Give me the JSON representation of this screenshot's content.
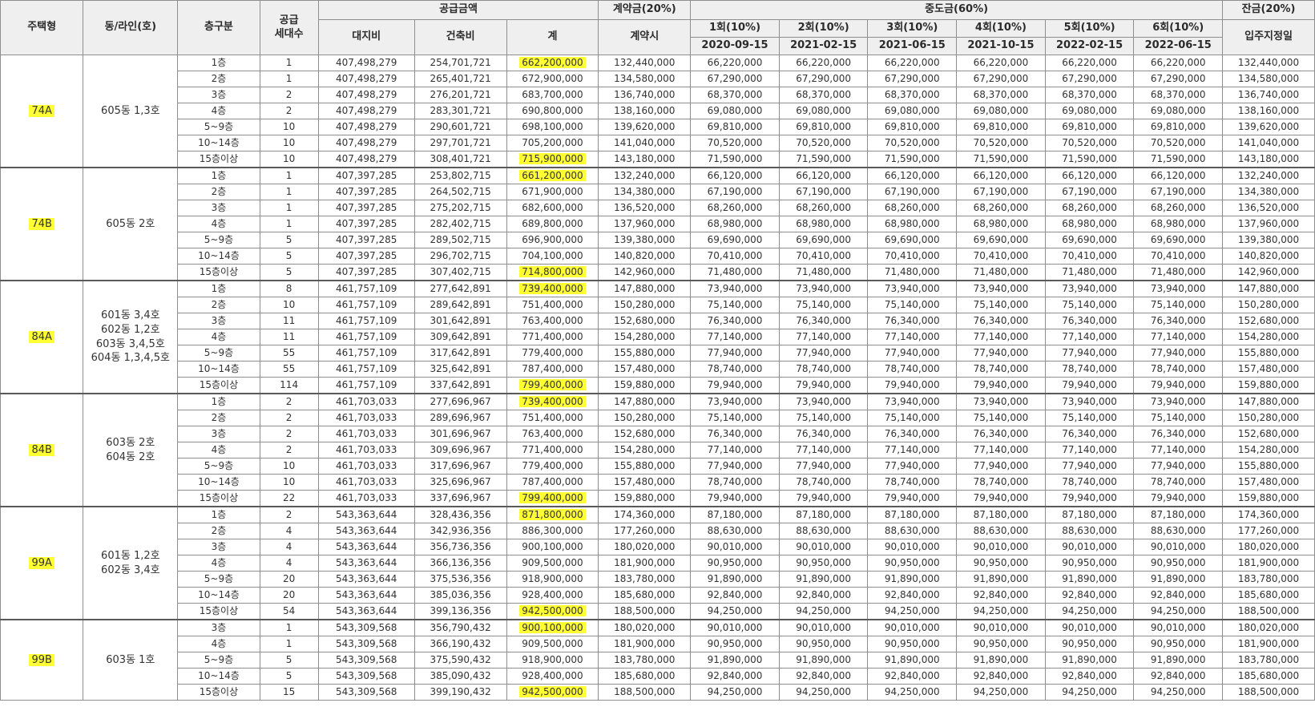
{
  "colors": {
    "highlight": "#ffff33",
    "header_bg": "#efefef",
    "border": "#8e8e8e"
  },
  "header": {
    "type": "주택형",
    "dong": "동/라인(호)",
    "floor": "층구분",
    "units": "공급\n세대수",
    "supply": "공급금액",
    "land": "대지비",
    "build": "건축비",
    "total": "계",
    "deposit": "계약금(20%)",
    "deposit_when": "계약시",
    "mid": "중도금(60%)",
    "mid_rounds": [
      "1회(10%)",
      "2회(10%)",
      "3회(10%)",
      "4회(10%)",
      "5회(10%)",
      "6회(10%)"
    ],
    "mid_dates": [
      "2020-09-15",
      "2021-02-15",
      "2021-06-15",
      "2021-10-15",
      "2022-02-15",
      "2022-06-15"
    ],
    "balance": "잔금(20%)",
    "balance_when": "입주지정일"
  },
  "groups": [
    {
      "type": "74A",
      "dong": "605동 1,3호",
      "rows": [
        {
          "floor": "1층",
          "units": "1",
          "land": "407,498,279",
          "build": "254,701,721",
          "total": "662,200,000",
          "hl": true,
          "deposit": "132,440,000",
          "mid": "66,220,000",
          "balance": "132,440,000"
        },
        {
          "floor": "2층",
          "units": "1",
          "land": "407,498,279",
          "build": "265,401,721",
          "total": "672,900,000",
          "hl": false,
          "deposit": "134,580,000",
          "mid": "67,290,000",
          "balance": "134,580,000"
        },
        {
          "floor": "3층",
          "units": "2",
          "land": "407,498,279",
          "build": "276,201,721",
          "total": "683,700,000",
          "hl": false,
          "deposit": "136,740,000",
          "mid": "68,370,000",
          "balance": "136,740,000"
        },
        {
          "floor": "4층",
          "units": "2",
          "land": "407,498,279",
          "build": "283,301,721",
          "total": "690,800,000",
          "hl": false,
          "deposit": "138,160,000",
          "mid": "69,080,000",
          "balance": "138,160,000"
        },
        {
          "floor": "5~9층",
          "units": "10",
          "land": "407,498,279",
          "build": "290,601,721",
          "total": "698,100,000",
          "hl": false,
          "deposit": "139,620,000",
          "mid": "69,810,000",
          "balance": "139,620,000"
        },
        {
          "floor": "10~14층",
          "units": "10",
          "land": "407,498,279",
          "build": "297,701,721",
          "total": "705,200,000",
          "hl": false,
          "deposit": "141,040,000",
          "mid": "70,520,000",
          "balance": "141,040,000"
        },
        {
          "floor": "15층이상",
          "units": "10",
          "land": "407,498,279",
          "build": "308,401,721",
          "total": "715,900,000",
          "hl": true,
          "deposit": "143,180,000",
          "mid": "71,590,000",
          "balance": "143,180,000"
        }
      ]
    },
    {
      "type": "74B",
      "dong": "605동 2호",
      "rows": [
        {
          "floor": "1층",
          "units": "1",
          "land": "407,397,285",
          "build": "253,802,715",
          "total": "661,200,000",
          "hl": true,
          "deposit": "132,240,000",
          "mid": "66,120,000",
          "balance": "132,240,000"
        },
        {
          "floor": "2층",
          "units": "1",
          "land": "407,397,285",
          "build": "264,502,715",
          "total": "671,900,000",
          "hl": false,
          "deposit": "134,380,000",
          "mid": "67,190,000",
          "balance": "134,380,000"
        },
        {
          "floor": "3층",
          "units": "1",
          "land": "407,397,285",
          "build": "275,202,715",
          "total": "682,600,000",
          "hl": false,
          "deposit": "136,520,000",
          "mid": "68,260,000",
          "balance": "136,520,000"
        },
        {
          "floor": "4층",
          "units": "1",
          "land": "407,397,285",
          "build": "282,402,715",
          "total": "689,800,000",
          "hl": false,
          "deposit": "137,960,000",
          "mid": "68,980,000",
          "balance": "137,960,000"
        },
        {
          "floor": "5~9층",
          "units": "5",
          "land": "407,397,285",
          "build": "289,502,715",
          "total": "696,900,000",
          "hl": false,
          "deposit": "139,380,000",
          "mid": "69,690,000",
          "balance": "139,380,000"
        },
        {
          "floor": "10~14층",
          "units": "5",
          "land": "407,397,285",
          "build": "296,702,715",
          "total": "704,100,000",
          "hl": false,
          "deposit": "140,820,000",
          "mid": "70,410,000",
          "balance": "140,820,000"
        },
        {
          "floor": "15층이상",
          "units": "5",
          "land": "407,397,285",
          "build": "307,402,715",
          "total": "714,800,000",
          "hl": true,
          "deposit": "142,960,000",
          "mid": "71,480,000",
          "balance": "142,960,000"
        }
      ]
    },
    {
      "type": "84A",
      "dong": "601동 3,4호\n602동 1,2호\n603동 3,4,5호\n604동 1,3,4,5호",
      "rows": [
        {
          "floor": "1층",
          "units": "8",
          "land": "461,757,109",
          "build": "277,642,891",
          "total": "739,400,000",
          "hl": true,
          "deposit": "147,880,000",
          "mid": "73,940,000",
          "balance": "147,880,000"
        },
        {
          "floor": "2층",
          "units": "10",
          "land": "461,757,109",
          "build": "289,642,891",
          "total": "751,400,000",
          "hl": false,
          "deposit": "150,280,000",
          "mid": "75,140,000",
          "balance": "150,280,000"
        },
        {
          "floor": "3층",
          "units": "11",
          "land": "461,757,109",
          "build": "301,642,891",
          "total": "763,400,000",
          "hl": false,
          "deposit": "152,680,000",
          "mid": "76,340,000",
          "balance": "152,680,000"
        },
        {
          "floor": "4층",
          "units": "11",
          "land": "461,757,109",
          "build": "309,642,891",
          "total": "771,400,000",
          "hl": false,
          "deposit": "154,280,000",
          "mid": "77,140,000",
          "balance": "154,280,000"
        },
        {
          "floor": "5~9층",
          "units": "55",
          "land": "461,757,109",
          "build": "317,642,891",
          "total": "779,400,000",
          "hl": false,
          "deposit": "155,880,000",
          "mid": "77,940,000",
          "balance": "155,880,000"
        },
        {
          "floor": "10~14층",
          "units": "55",
          "land": "461,757,109",
          "build": "325,642,891",
          "total": "787,400,000",
          "hl": false,
          "deposit": "157,480,000",
          "mid": "78,740,000",
          "balance": "157,480,000"
        },
        {
          "floor": "15층이상",
          "units": "114",
          "land": "461,757,109",
          "build": "337,642,891",
          "total": "799,400,000",
          "hl": true,
          "deposit": "159,880,000",
          "mid": "79,940,000",
          "balance": "159,880,000"
        }
      ]
    },
    {
      "type": "84B",
      "dong": "603동 2호\n604동 2호",
      "rows": [
        {
          "floor": "1층",
          "units": "2",
          "land": "461,703,033",
          "build": "277,696,967",
          "total": "739,400,000",
          "hl": true,
          "deposit": "147,880,000",
          "mid": "73,940,000",
          "balance": "147,880,000"
        },
        {
          "floor": "2층",
          "units": "2",
          "land": "461,703,033",
          "build": "289,696,967",
          "total": "751,400,000",
          "hl": false,
          "deposit": "150,280,000",
          "mid": "75,140,000",
          "balance": "150,280,000"
        },
        {
          "floor": "3층",
          "units": "2",
          "land": "461,703,033",
          "build": "301,696,967",
          "total": "763,400,000",
          "hl": false,
          "deposit": "152,680,000",
          "mid": "76,340,000",
          "balance": "152,680,000"
        },
        {
          "floor": "4층",
          "units": "2",
          "land": "461,703,033",
          "build": "309,696,967",
          "total": "771,400,000",
          "hl": false,
          "deposit": "154,280,000",
          "mid": "77,140,000",
          "balance": "154,280,000"
        },
        {
          "floor": "5~9층",
          "units": "10",
          "land": "461,703,033",
          "build": "317,696,967",
          "total": "779,400,000",
          "hl": false,
          "deposit": "155,880,000",
          "mid": "77,940,000",
          "balance": "155,880,000"
        },
        {
          "floor": "10~14층",
          "units": "10",
          "land": "461,703,033",
          "build": "325,696,967",
          "total": "787,400,000",
          "hl": false,
          "deposit": "157,480,000",
          "mid": "78,740,000",
          "balance": "157,480,000"
        },
        {
          "floor": "15층이상",
          "units": "22",
          "land": "461,703,033",
          "build": "337,696,967",
          "total": "799,400,000",
          "hl": true,
          "deposit": "159,880,000",
          "mid": "79,940,000",
          "balance": "159,880,000"
        }
      ]
    },
    {
      "type": "99A",
      "dong": "601동 1,2호\n602동 3,4호",
      "rows": [
        {
          "floor": "1층",
          "units": "2",
          "land": "543,363,644",
          "build": "328,436,356",
          "total": "871,800,000",
          "hl": true,
          "deposit": "174,360,000",
          "mid": "87,180,000",
          "balance": "174,360,000"
        },
        {
          "floor": "2층",
          "units": "4",
          "land": "543,363,644",
          "build": "342,936,356",
          "total": "886,300,000",
          "hl": false,
          "deposit": "177,260,000",
          "mid": "88,630,000",
          "balance": "177,260,000"
        },
        {
          "floor": "3층",
          "units": "4",
          "land": "543,363,644",
          "build": "356,736,356",
          "total": "900,100,000",
          "hl": false,
          "deposit": "180,020,000",
          "mid": "90,010,000",
          "balance": "180,020,000"
        },
        {
          "floor": "4층",
          "units": "4",
          "land": "543,363,644",
          "build": "366,136,356",
          "total": "909,500,000",
          "hl": false,
          "deposit": "181,900,000",
          "mid": "90,950,000",
          "balance": "181,900,000"
        },
        {
          "floor": "5~9층",
          "units": "20",
          "land": "543,363,644",
          "build": "375,536,356",
          "total": "918,900,000",
          "hl": false,
          "deposit": "183,780,000",
          "mid": "91,890,000",
          "balance": "183,780,000"
        },
        {
          "floor": "10~14층",
          "units": "20",
          "land": "543,363,644",
          "build": "385,036,356",
          "total": "928,400,000",
          "hl": false,
          "deposit": "185,680,000",
          "mid": "92,840,000",
          "balance": "185,680,000"
        },
        {
          "floor": "15층이상",
          "units": "54",
          "land": "543,363,644",
          "build": "399,136,356",
          "total": "942,500,000",
          "hl": true,
          "deposit": "188,500,000",
          "mid": "94,250,000",
          "balance": "188,500,000"
        }
      ]
    },
    {
      "type": "99B",
      "dong": "603동 1호",
      "rows": [
        {
          "floor": "3층",
          "units": "1",
          "land": "543,309,568",
          "build": "356,790,432",
          "total": "900,100,000",
          "hl": true,
          "deposit": "180,020,000",
          "mid": "90,010,000",
          "balance": "180,020,000"
        },
        {
          "floor": "4층",
          "units": "1",
          "land": "543,309,568",
          "build": "366,190,432",
          "total": "909,500,000",
          "hl": false,
          "deposit": "181,900,000",
          "mid": "90,950,000",
          "balance": "181,900,000"
        },
        {
          "floor": "5~9층",
          "units": "5",
          "land": "543,309,568",
          "build": "375,590,432",
          "total": "918,900,000",
          "hl": false,
          "deposit": "183,780,000",
          "mid": "91,890,000",
          "balance": "183,780,000"
        },
        {
          "floor": "10~14층",
          "units": "5",
          "land": "543,309,568",
          "build": "385,090,432",
          "total": "928,400,000",
          "hl": false,
          "deposit": "185,680,000",
          "mid": "92,840,000",
          "balance": "185,680,000"
        },
        {
          "floor": "15층이상",
          "units": "15",
          "land": "543,309,568",
          "build": "399,190,432",
          "total": "942,500,000",
          "hl": true,
          "deposit": "188,500,000",
          "mid": "94,250,000",
          "balance": "188,500,000"
        }
      ]
    }
  ]
}
